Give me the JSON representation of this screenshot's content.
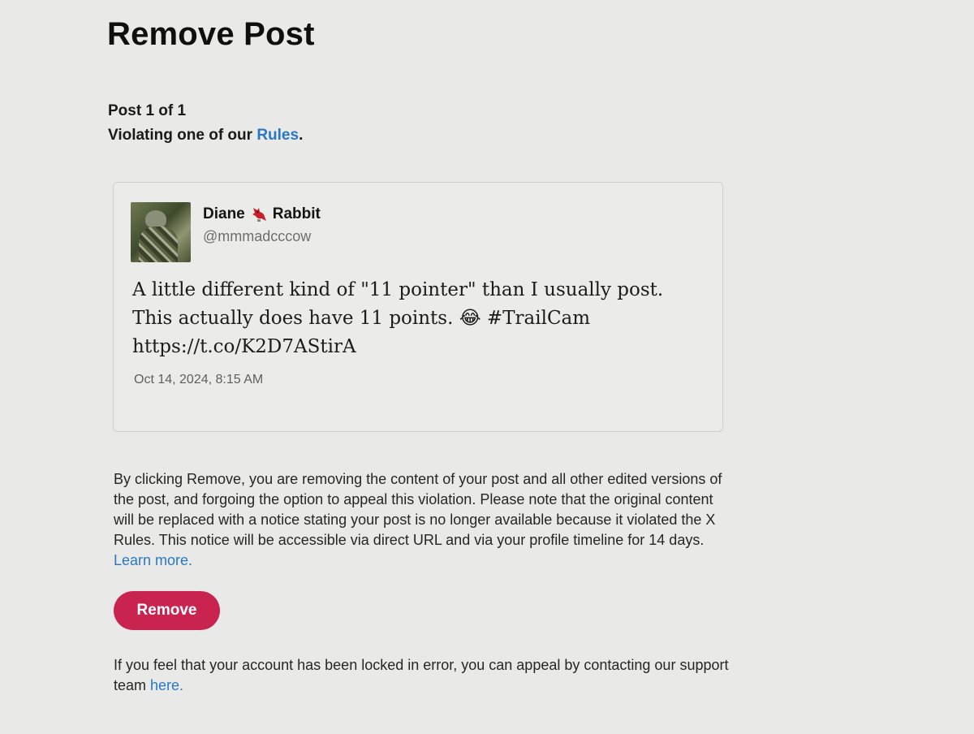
{
  "page": {
    "title": "Remove Post",
    "post_count": "Post 1 of 1",
    "reason_prefix": "Violating one of our ",
    "reason_link": "Rules",
    "reason_suffix": "."
  },
  "post": {
    "display_name_first": "Diane",
    "display_name_last": "Rabbit",
    "name_icon": "cardinal-bird-icon",
    "handle": "@mmmadcccow",
    "text_line1": "A little different kind of \"11 pointer\" than I usually post.",
    "text_line2_before": "This actually does have 11 points. ",
    "text_emoji": "😂",
    "text_line2_after": " #TrailCam",
    "text_line3": "https://t.co/K2D7AStirA",
    "timestamp": "Oct 14, 2024, 8:15 AM"
  },
  "notice": {
    "line1": "By clicking Remove, you are removing the content of your post and all other edited versions of",
    "line2": "the post, and forgoing the option to appeal this violation. Please note that the original content",
    "line3": "will be replaced with a notice stating your post is no longer available because it violated the X",
    "line4": "Rules. This notice will be accessible via direct URL and via your profile timeline for 14 days.",
    "learn_more": "Learn more."
  },
  "actions": {
    "remove_label": "Remove"
  },
  "appeal": {
    "line1": "If you feel that your account has been locked in error, you can appeal by contacting our support",
    "line2_prefix": "team ",
    "line2_link": "here."
  },
  "colors": {
    "background": "#e9e9e7",
    "link": "#2b78c2",
    "remove_button": "#c8244f"
  }
}
